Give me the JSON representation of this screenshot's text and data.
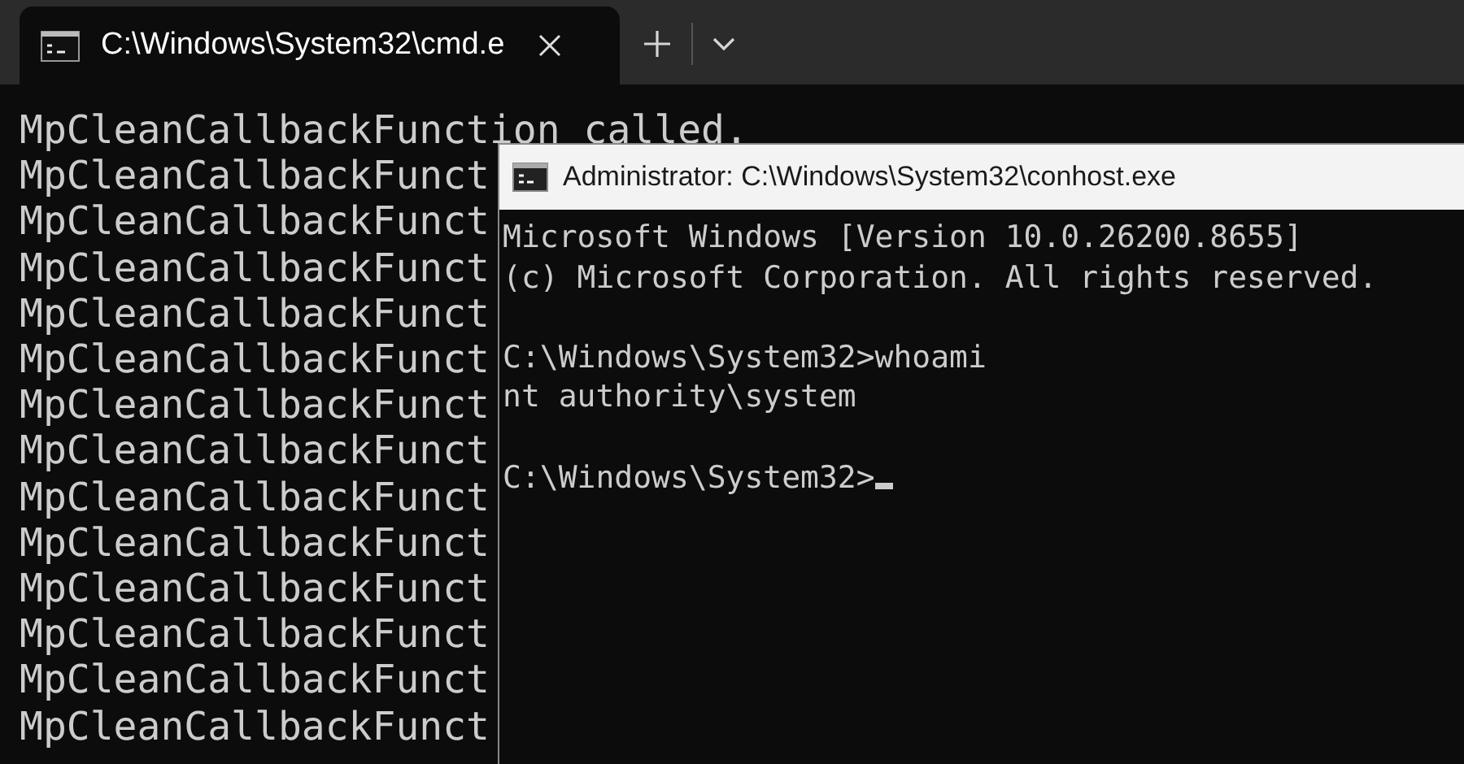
{
  "tabs": [
    {
      "title": "C:\\Windows\\System32\\cmd.e",
      "selected": true
    }
  ],
  "terminal": {
    "lines": [
      "MpCleanCallbackFunction called.",
      "MpCleanCallbackFunct",
      "MpCleanCallbackFunct",
      "MpCleanCallbackFunct",
      "MpCleanCallbackFunct",
      "MpCleanCallbackFunct",
      "MpCleanCallbackFunct",
      "MpCleanCallbackFunct",
      "MpCleanCallbackFunct",
      "MpCleanCallbackFunct",
      "MpCleanCallbackFunct",
      "MpCleanCallbackFunct",
      "MpCleanCallbackFunct",
      "MpCleanCallbackFunct"
    ]
  },
  "console_window": {
    "title": "Administrator: C:\\Windows\\System32\\conhost.exe",
    "blocks": [
      [
        "Microsoft Windows [Version 10.0.26200.8655]",
        "(c) Microsoft Corporation. All rights reserved."
      ],
      [
        "C:\\Windows\\System32>whoami",
        "nt authority\\system"
      ]
    ],
    "prompt": "C:\\Windows\\System32>",
    "cursor_visible": true
  }
}
